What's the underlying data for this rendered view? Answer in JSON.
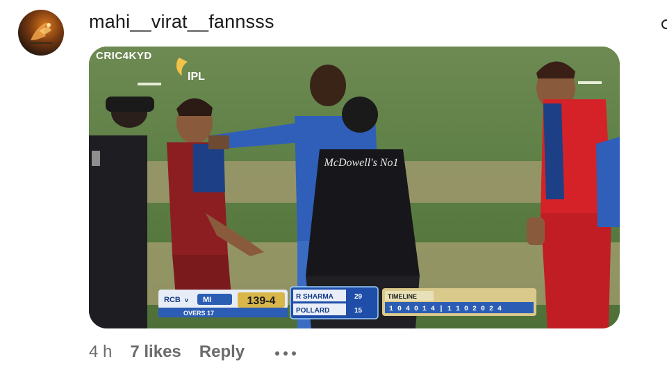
{
  "comment": {
    "username": "mahi__virat__fannsss",
    "time": "4 h",
    "likes": "7 likes",
    "reply_label": "Reply",
    "more_icon": "more-horizontal-icon",
    "avatar_icon": "profile-avatar",
    "media": {
      "watermark": "CRIC4KYD",
      "logo_text": "IPL",
      "umpire_shirt": "McDowell's No1",
      "scoreboard": {
        "team1": "RCB",
        "versus": "v",
        "team2": "MI",
        "score": "139-4",
        "overs": "OVERS 17",
        "batsman1_name": "R SHARMA",
        "batsman1_score": "29",
        "batsman2_name": "POLLARD",
        "batsman2_score": "15",
        "timeline_label": "TIMELINE",
        "timeline_values": "1 0 4 0 1 4 | 1 1 0 2 0 2 4"
      }
    }
  }
}
